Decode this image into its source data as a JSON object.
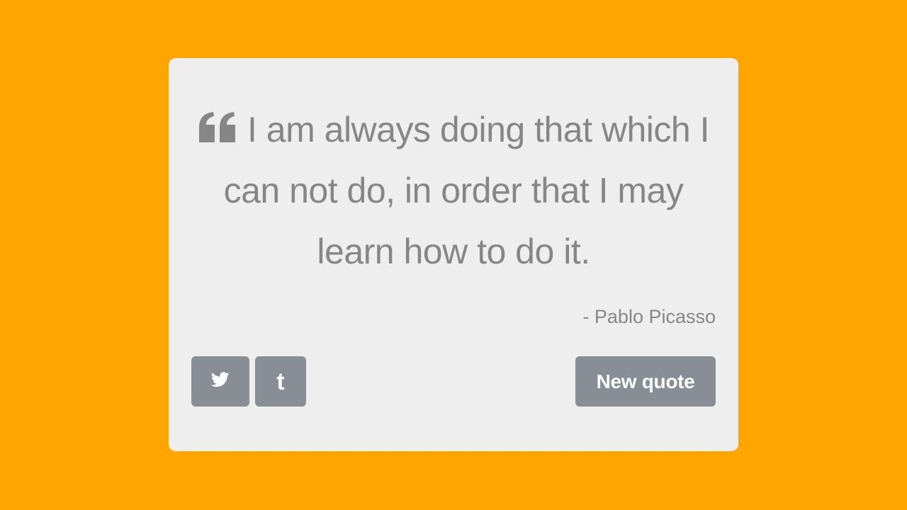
{
  "quote": {
    "text": "I am always doing that which I can not do, in order that I may learn how to do it.",
    "author": "- Pablo Picasso",
    "icon": "quote-left-icon"
  },
  "actions": {
    "twitter_icon": "twitter-icon",
    "tumblr_icon": "tumblr-icon",
    "tumblr_glyph": "t",
    "new_quote_label": "New quote"
  },
  "colors": {
    "background": "#ffa500",
    "card": "#eeeeee",
    "text": "#868686",
    "button": "#888e95",
    "button_text": "#ffffff"
  }
}
